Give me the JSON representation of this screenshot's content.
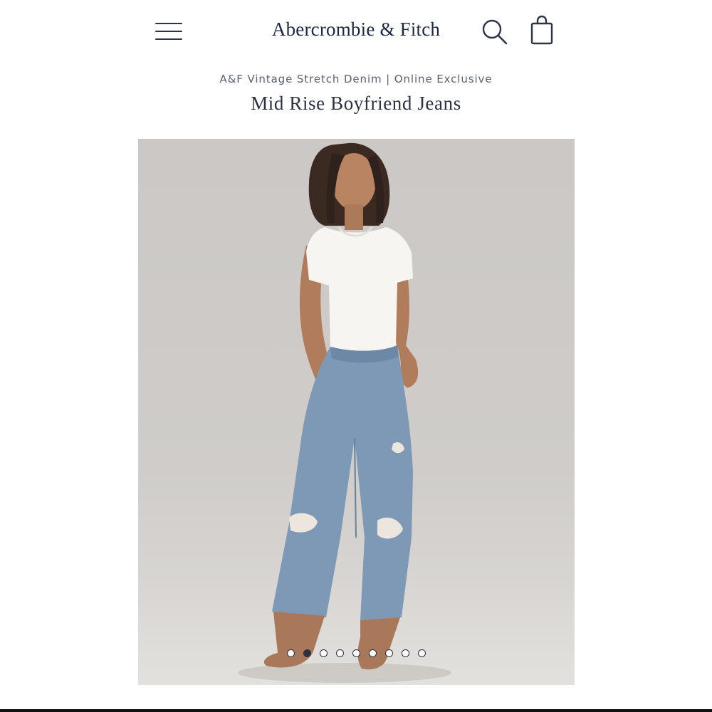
{
  "header": {
    "brand": "Abercrombie & Fitch",
    "menu_icon": "hamburger-menu-icon",
    "search_icon": "search-icon",
    "bag_icon": "shopping-bag-icon"
  },
  "product": {
    "collection": "A&F Vintage Stretch Denim | Online Exclusive",
    "title": "Mid Rise Boyfriend Jeans"
  },
  "gallery": {
    "image_count": 9,
    "active_index": 1
  },
  "colors": {
    "brand_navy": "#1d2740",
    "photo_background": "#cbc8c5"
  }
}
